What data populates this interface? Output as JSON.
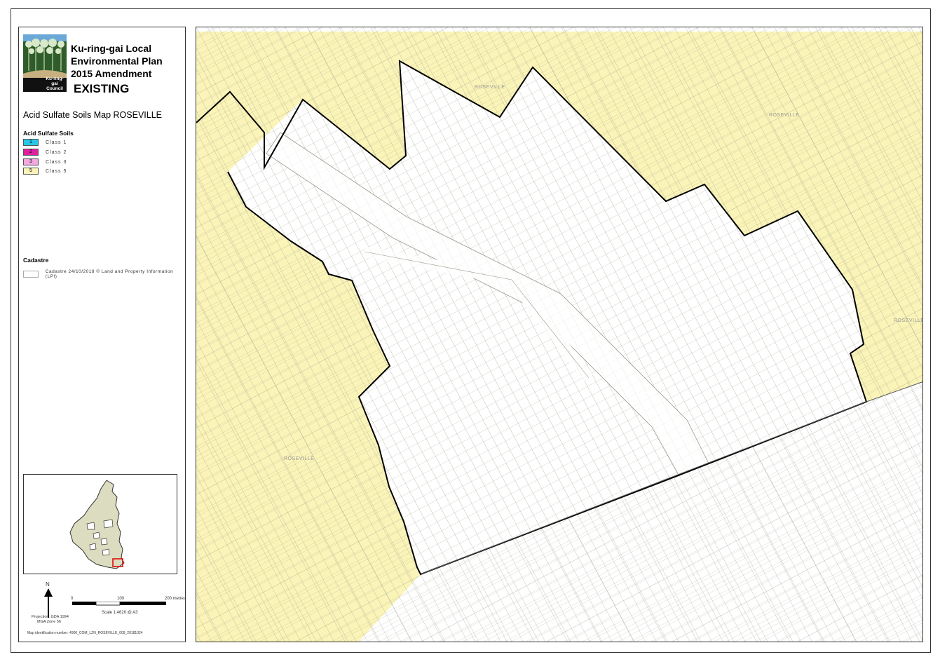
{
  "header": {
    "title_lines": [
      "Ku-ring-gai Local",
      "Environmental Plan",
      "2015 Amendment"
    ],
    "status": "EXISTING",
    "map_title": "Acid Sulfate Soils Map ROSEVILLE",
    "logo_text": [
      "Ku-ring-gai",
      "Council"
    ]
  },
  "legend": {
    "heading": "Acid Sulfate Soils",
    "items": [
      {
        "code": "1",
        "label": "Class 1",
        "color": "#26c6e8"
      },
      {
        "code": "2",
        "label": "Class 2",
        "color": "#e020a0"
      },
      {
        "code": "3",
        "label": "Class 3",
        "color": "#f4a8e0"
      },
      {
        "code": "5",
        "label": "Class 5",
        "color": "#fbf4b8"
      }
    ],
    "cadastre_heading": "Cadastre",
    "cadastre_label": "Cadastre 24/10/2018 © Land and Property Information (LPI)"
  },
  "scale": {
    "ticks": [
      "0",
      "100",
      "200 metres"
    ],
    "scale_text": "Scale  1:4620  @ A3",
    "north": "N",
    "projection": "Projection: GDA 1994",
    "zone": "MGA Zone 56",
    "map_id": "Map identification number:  4900_COM_LZN_ROSEVILLE_009_20181024"
  },
  "map_labels": {
    "suburb": "ROSEVILLE"
  },
  "colors": {
    "class5": "#fbf4b8",
    "parcel_line": "#9a9a8a",
    "boundary": "#000000",
    "inset_fill": "#dcdcc0",
    "highlight": "#e00000"
  }
}
